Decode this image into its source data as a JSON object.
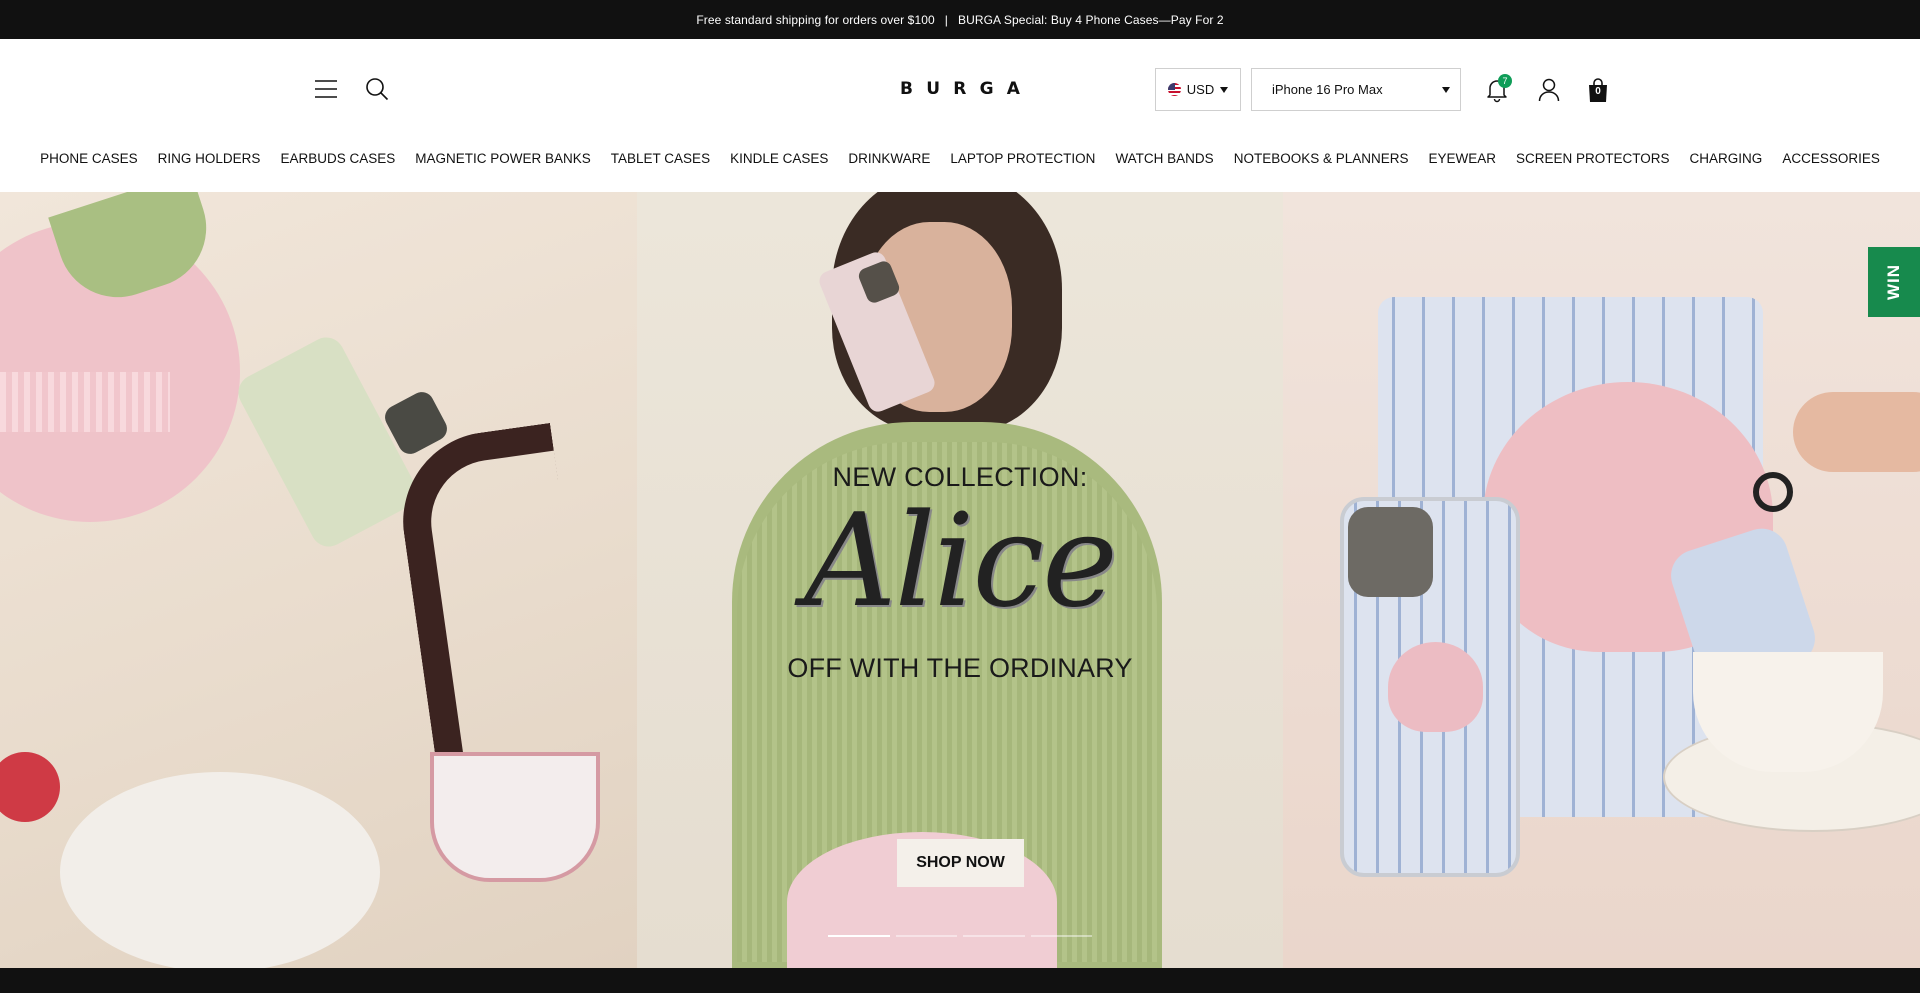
{
  "announcement": {
    "left": "Free standard shipping for orders over $100",
    "separator": "|",
    "right": "BURGA Special: Buy 4 Phone Cases—Pay For 2"
  },
  "header": {
    "logo_letters": [
      "B",
      "U",
      "R",
      "G",
      "A"
    ],
    "currency": "USD",
    "device": "iPhone 16 Pro Max",
    "notification_count": "7",
    "cart_count": "0",
    "icons": [
      "menu-icon",
      "search-icon",
      "bell-icon",
      "user-icon",
      "bag-icon"
    ]
  },
  "nav": {
    "items": [
      "PHONE CASES",
      "RING HOLDERS",
      "EARBUDS CASES",
      "MAGNETIC POWER BANKS",
      "TABLET CASES",
      "KINDLE CASES",
      "DRINKWARE",
      "LAPTOP PROTECTION",
      "WATCH BANDS",
      "NOTEBOOKS & PLANNERS",
      "EYEWEAR",
      "SCREEN PROTECTORS",
      "CHARGING",
      "ACCESSORIES"
    ]
  },
  "hero": {
    "eyebrow": "NEW COLLECTION:",
    "title": "Alice",
    "subtitle": "OFF WITH THE ORDINARY",
    "cta": "SHOP NOW",
    "slide_count": 4,
    "active_slide": 1
  },
  "win_tab": "WIN",
  "footer_partial": "",
  "colors": {
    "announcement_bg": "#111111",
    "badge_green": "#0f9d58",
    "win_green": "#178a4d",
    "hero_button_bg": "#f4f0ea"
  }
}
